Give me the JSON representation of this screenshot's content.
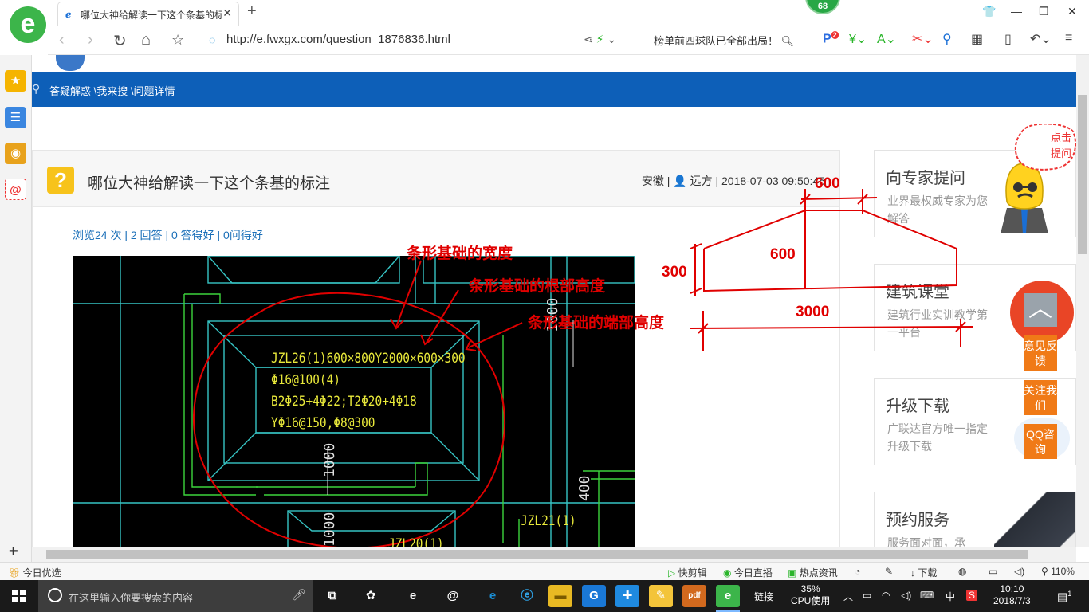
{
  "browser": {
    "logo_glyph": "e",
    "tab_title": "哪位大神给解读一下这个条基的标注",
    "tab_close": "✕",
    "new_tab": "+",
    "notification_count": "68",
    "url": "http://e.fwxgx.com/question_1876836.html",
    "news_ticker": "榜单前四球队已全部出局！",
    "ext_badge": "2"
  },
  "page": {
    "breadcrumb": "答疑解惑 \\我来搜 \\问题详情",
    "question": {
      "title": "哪位大神给解读一下这个条基的标注",
      "meta": "安徽 | 👤 远方 | 2018-07-03 09:50:45",
      "stats": "浏览24 次 | 2 回答 | 0 答得好 | 0问得好"
    },
    "cad": {
      "label_lines": [
        "JZL26(1)600×800Y2000×600×300",
        "Φ16@100(4)",
        "B2Φ25+4Φ22;T2Φ20+4Φ18",
        "YΦ16@150,Φ8@300"
      ],
      "dim_1000_a": "1000",
      "dim_1000_b": "1000",
      "dim_1000_c": "1000",
      "dim_400": "400",
      "label_jzl21": "JZL21(1)",
      "label_jzl20": "JZL20(1)"
    },
    "annotations": {
      "width_label": "条形基础的宽度",
      "root_height_label": "条形基础的根部高度",
      "end_height_label": "条形基础的端部高度",
      "dim_600_top": "600",
      "dim_600_mid": "600",
      "dim_300": "300",
      "dim_3000": "3000"
    },
    "right_cards": [
      {
        "title": "向专家提问",
        "sub": "业界最权威专家为您解答"
      },
      {
        "title": "建筑课堂",
        "sub": "建筑行业实训教学第一平台"
      },
      {
        "title": "升级下载",
        "sub": "广联达官方唯一指定升级下载"
      },
      {
        "title": "预约服务",
        "sub": "服务面对面，承"
      }
    ],
    "tip_bubble": "点击提问",
    "float_buttons": [
      "意见反馈",
      "关注我们",
      "QQ咨询"
    ]
  },
  "statusbar": {
    "left": "今日优选",
    "kuaijianji": "快剪辑",
    "live": "今日直播",
    "news": "热点资讯",
    "download": "下载",
    "zoom": "110%"
  },
  "taskbar": {
    "search_placeholder": "在这里输入你要搜索的内容",
    "link_label": "链接",
    "cpu_percent": "35%",
    "cpu_label": "CPU使用",
    "ime": "中",
    "time": "10:10",
    "date": "2018/7/3",
    "notif_count": "1"
  },
  "colors": {
    "brand_blue": "#0d5fb8",
    "annotation_red": "#e00000",
    "cad_yellow": "#e8e83a",
    "cad_cyan": "#36c4c4",
    "cad_green": "#3cd43c"
  }
}
